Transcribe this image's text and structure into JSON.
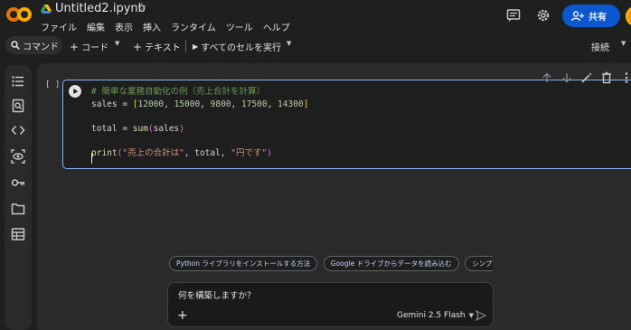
{
  "header": {
    "title": "Untitled2.ipynb",
    "menu": [
      "ファイル",
      "編集",
      "表示",
      "挿入",
      "ランタイム",
      "ツール",
      "ヘルプ"
    ],
    "share_label": "共有"
  },
  "toolbar": {
    "command_label": "コマンド",
    "code_label": "コード",
    "text_label": "テキスト",
    "run_all_label": "すべてのセルを実行",
    "connect_label": "接続"
  },
  "cell": {
    "bracket": "[ ]",
    "lines": [
      "# 簡単な業務自動化の例（売上合計を計算）",
      "sales = [12000, 15000, 9800, 17500, 14300]",
      "",
      "total = sum(sales)",
      "",
      "print(\"売上の合計は\", total, \"円です\")"
    ]
  },
  "suggestions": [
    "Python ライブラリをインストールする方法",
    "Google ドライブからデータを読み込む",
    "シンプルなＭ"
  ],
  "gemini": {
    "placeholder": "何を構築しますか？",
    "model": "Gemini 2.5 Flash"
  },
  "colors": {
    "accent": "#0b57d0",
    "cell_border": "#8ab4f8",
    "logo_orange": "#f9ab00",
    "logo_dark_orange": "#e8710a"
  }
}
